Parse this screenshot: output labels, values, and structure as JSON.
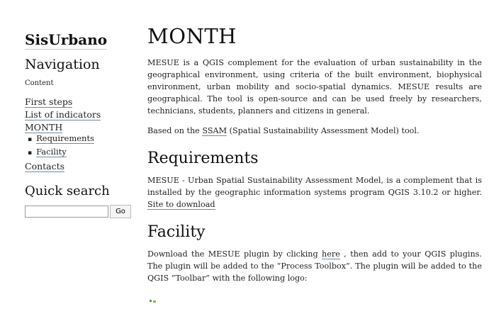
{
  "sidebar": {
    "brand": "SisUrbano",
    "navigation_heading": "Navigation",
    "content_caption": "Content",
    "toc": {
      "first_steps": "First steps",
      "indicators": "List of indicators",
      "month": "MONTH",
      "requirements": "Requirements",
      "facility": "Facility",
      "contacts": "Contacts"
    },
    "quick_search_heading": "Quick search",
    "search_value": "",
    "go_label": "Go"
  },
  "main": {
    "title": "MONTH",
    "intro": "MESUE is a QGIS complement for the evaluation of urban sustainability in the geographical environment, using criteria of the built environment, biophysical environment, urban mobility and socio-spatial dynamics. MESUE results are geographical. The tool is open-source and can be used freely by researchers, technicians, students, planners and citizens in general.",
    "based_on_prefix": "Based on the ",
    "ssam_link": "SSAM",
    "based_on_suffix": " (Spatial Sustainability Assessment Model) tool.",
    "requirements_heading": "Requirements",
    "requirements_text": "MESUE - Urban Spatial Sustainability Assessment Model, is a complement that is installed by the geographic information systems program QGIS 3.10.2 or higher. ",
    "site_link": "Site to download",
    "facility_heading": "Facility",
    "facility_prefix": "Download the MESUE plugin by clicking ",
    "here_link": "here",
    "facility_suffix": " , then add to your QGIS plugins. The plugin will be added to the “Process Toolbox”. The plugin will be added to the QGIS “Toolbar” with the following logo:"
  },
  "colors": {
    "link_underline": "#6d8ba3",
    "logo_green": "#5aa02c"
  }
}
